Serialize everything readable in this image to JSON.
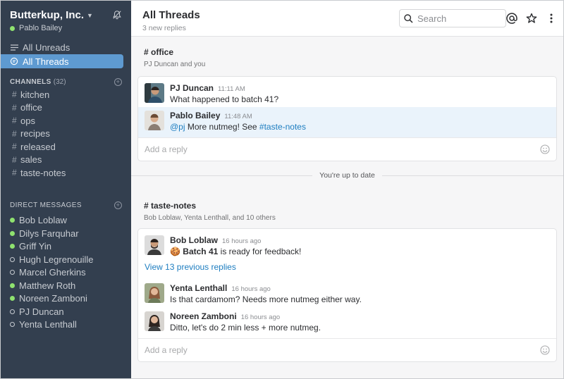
{
  "team": {
    "name": "Butterkup, Inc.",
    "user": "Pablo Bailey"
  },
  "nav": [
    {
      "label": "All Unreads",
      "active": false
    },
    {
      "label": "All Threads",
      "active": true
    }
  ],
  "channels": {
    "heading": "CHANNELS",
    "count": "(32)",
    "items": [
      "kitchen",
      "office",
      "ops",
      "recipes",
      "released",
      "sales",
      "taste-notes"
    ]
  },
  "dms": {
    "heading": "DIRECT MESSAGES",
    "items": [
      {
        "name": "Bob Loblaw",
        "status": "online"
      },
      {
        "name": "Dilys Farquhar",
        "status": "online"
      },
      {
        "name": "Griff Yin",
        "status": "online"
      },
      {
        "name": "Hugh Legrenouille",
        "status": "away"
      },
      {
        "name": "Marcel Gherkins",
        "status": "away"
      },
      {
        "name": "Matthew Roth",
        "status": "online"
      },
      {
        "name": "Noreen Zamboni",
        "status": "online"
      },
      {
        "name": "PJ Duncan",
        "status": "away"
      },
      {
        "name": "Yenta Lenthall",
        "status": "away"
      }
    ]
  },
  "header": {
    "title": "All Threads",
    "subtitle": "3 new replies",
    "search_placeholder": "Search"
  },
  "threads": [
    {
      "channel": "# office",
      "members": "PJ Duncan and you",
      "messages": [
        {
          "author": "PJ Duncan",
          "time": "11:11 AM",
          "text": "What happened to batch 41?"
        },
        {
          "author": "Pablo Bailey",
          "time": "11:48 AM",
          "mention": "@pj",
          "text_mid": " More nutmeg! See ",
          "channel_link": "#taste-notes"
        }
      ],
      "reply_placeholder": "Add a reply"
    },
    {
      "channel": "# taste-notes",
      "members": "Bob Loblaw, Yenta Lenthall, and 10 others",
      "messages": [
        {
          "author": "Bob Loblaw",
          "time": "16 hours ago",
          "emoji": "🍪",
          "bold": "Batch 41",
          "text": " is ready for feedback!"
        },
        {
          "author": "Yenta Lenthall",
          "time": "16 hours ago",
          "text": "Is that cardamom? Needs more nutmeg either way."
        },
        {
          "author": "Noreen Zamboni",
          "time": "16 hours ago",
          "text": "Ditto, let's do 2 min less + more nutmeg."
        }
      ],
      "view_previous": "View 13 previous replies",
      "reply_placeholder": "Add a reply"
    }
  ],
  "divider": "You're up to date",
  "colors": {
    "sidebar": "#333f4f",
    "active_item": "#5e9ad1",
    "online": "#8fe26f",
    "link": "#1d7dc0",
    "highlight": "#eaf3fb"
  }
}
